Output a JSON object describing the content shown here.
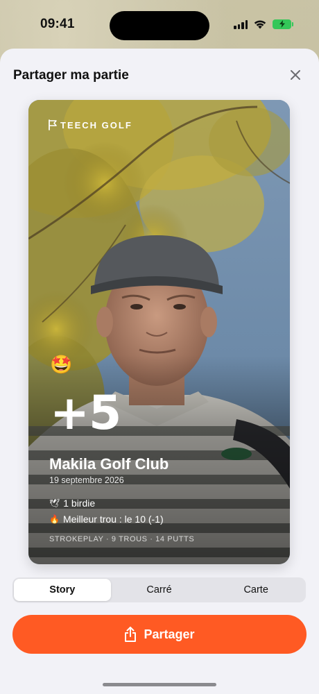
{
  "status_bar": {
    "time": "09:41"
  },
  "sheet": {
    "title": "Partager ma partie"
  },
  "card": {
    "brand": "TEECH GOLF",
    "emoji": "🤩",
    "score": "+5",
    "club_name": "Makila Golf Club",
    "date": "19 septembre 2026",
    "stats": [
      {
        "icon": "🕊",
        "icon_name": "bird-icon",
        "text": "1 birdie"
      },
      {
        "icon": "🔥",
        "icon_name": "fire-icon",
        "text": "Meilleur trou : le 10 (-1)"
      }
    ],
    "footer": "STROKEPLAY · 9 TROUS · 14 PUTTS"
  },
  "format_tabs": {
    "options": [
      "Story",
      "Carré",
      "Carte"
    ],
    "selected": "Story"
  },
  "share_button": {
    "label": "Partager"
  },
  "colors": {
    "accent": "#ff5a23",
    "sheet_background": "#f2f2f7",
    "battery": "#34c759"
  }
}
